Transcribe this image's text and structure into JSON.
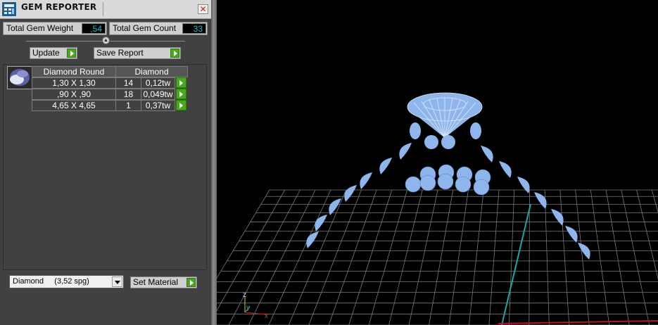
{
  "window": {
    "title": "GEM REPORTER",
    "close_glyph": "✕"
  },
  "summary": {
    "weight_label": "Total Gem Weight",
    "weight_value": ",54",
    "count_label": "Total Gem Count",
    "count_value": "33"
  },
  "actions": {
    "update_label": "Update",
    "save_label": "Save Report"
  },
  "table": {
    "col_shape": "Diamond Round",
    "col_material": "Diamond",
    "rows": [
      {
        "size": "1,30 X 1,30",
        "count": "14",
        "weight": "0,12tw"
      },
      {
        "size": ",90 X ,90",
        "count": "18",
        "weight": "0,049tw"
      },
      {
        "size": "4,65 X 4,65",
        "count": "1",
        "weight": "0,37tw"
      }
    ]
  },
  "material": {
    "selected": "Diamond     (3,52 spg)",
    "set_label": "Set Material"
  },
  "viewport": {
    "axis_z": "z",
    "axis_y": "y",
    "axis_x": "x",
    "gem_color": "#8fb6ec",
    "grid_color": "#7a7a7a"
  },
  "icons": {
    "app": "gem-reporter-app-icon",
    "close": "close-icon",
    "run": "green-arrow-icon",
    "dropdown": "chevron-down-icon"
  }
}
